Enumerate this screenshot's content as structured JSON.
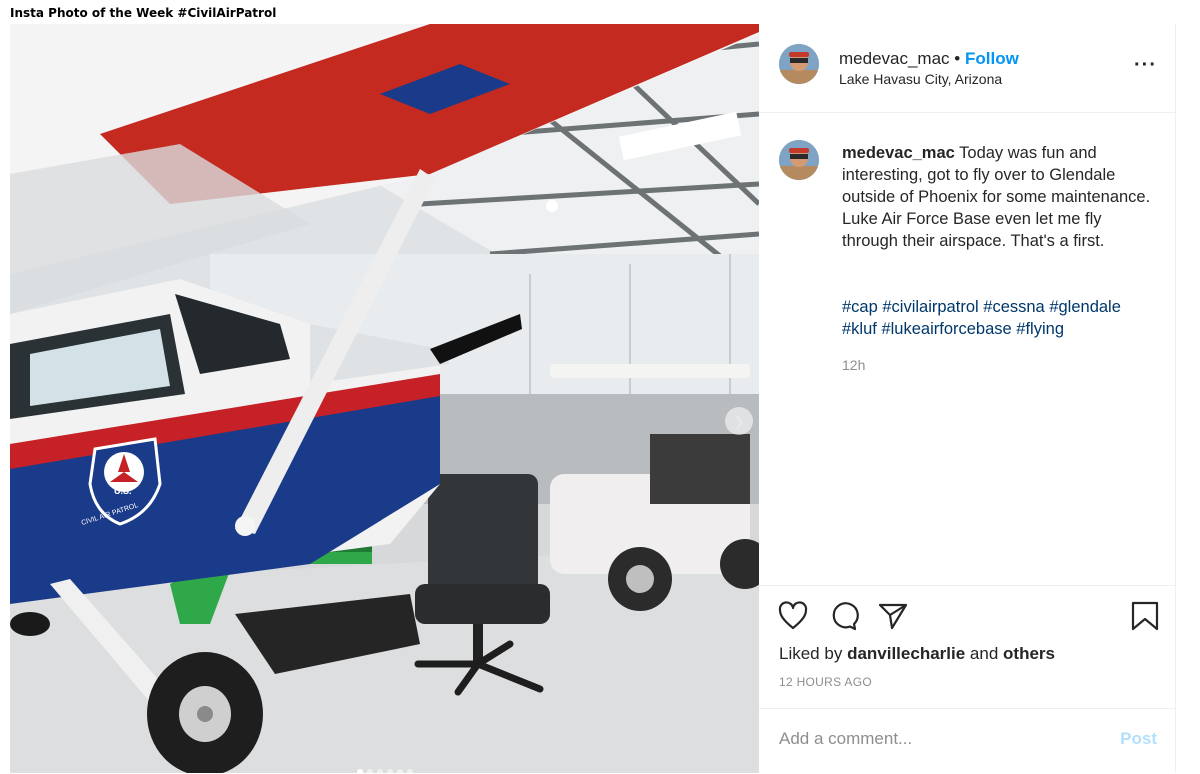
{
  "page_heading": "Insta Photo of the Week #CivilAirPatrol",
  "post": {
    "username": "medevac_mac",
    "separator": "•",
    "follow_label": "Follow",
    "location": "Lake Havasu City, Arizona",
    "caption_user": "medevac_mac",
    "caption_text": "Today was fun and interesting, got to fly over to Glendale outside of Phoenix for some maintenance. Luke Air Force Base even let me fly through their airspace. That's a first.",
    "hashtags": [
      "#cap",
      "#civilairpatrol",
      "#cessna",
      "#glendale",
      "#kluf",
      "#lukeairforcebase",
      "#flying"
    ],
    "time_posted": "12h",
    "liked_prefix": "Liked by",
    "liked_user": "danvillecharlie",
    "liked_and": "and",
    "liked_others": "others",
    "posted_ago": "12 HOURS AGO",
    "comment_placeholder": "Add a comment...",
    "post_label": "Post",
    "carousel_count": 6,
    "carousel_active": 1
  },
  "photo": {
    "badge_top": "U.S.",
    "badge_bottom": "CIVIL AIR PATROL"
  },
  "colors": {
    "follow": "#0095f6",
    "hashtag": "#00376b",
    "muted": "#8e8e8e",
    "post_disabled": "#b2dffc"
  },
  "icons": [
    "more-options-icon",
    "heart-icon",
    "comment-icon",
    "share-icon",
    "bookmark-icon",
    "next-arrow-icon"
  ]
}
